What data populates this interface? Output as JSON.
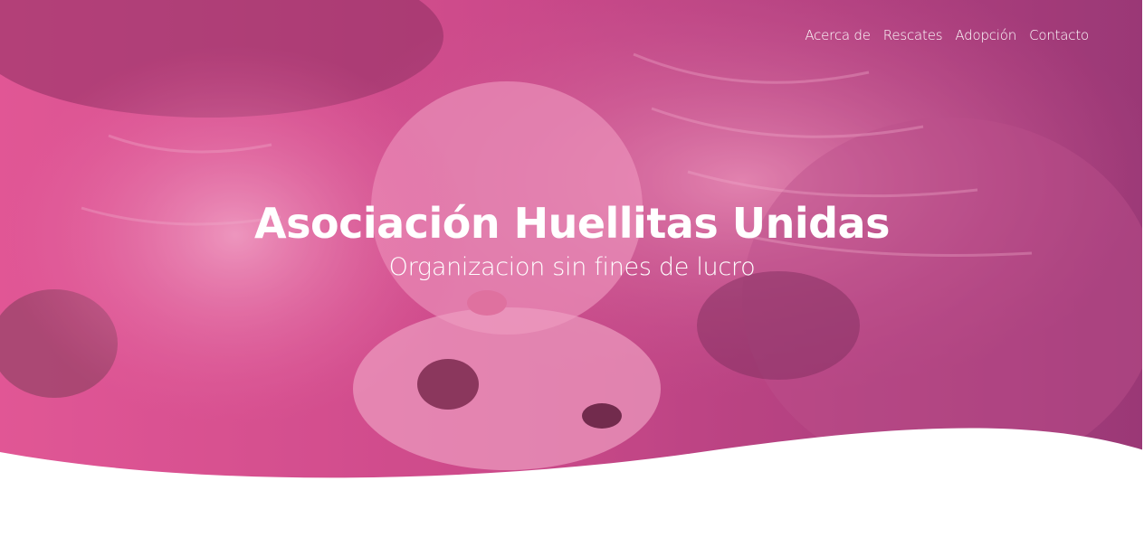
{
  "colors": {
    "overlay_top": "#9b2c6b",
    "overlay_bottom": "#e04b89",
    "text": "#ffffff",
    "page_bg": "#ffffff"
  },
  "nav": {
    "items": [
      {
        "label": "Acerca de"
      },
      {
        "label": "Rescates"
      },
      {
        "label": "Adopción"
      },
      {
        "label": "Contacto"
      }
    ]
  },
  "hero": {
    "title": "Asociación Huellitas Unidas",
    "subtitle": "Organizacion sin fines de lucro",
    "background": "kitten-and-puppy-photo"
  }
}
